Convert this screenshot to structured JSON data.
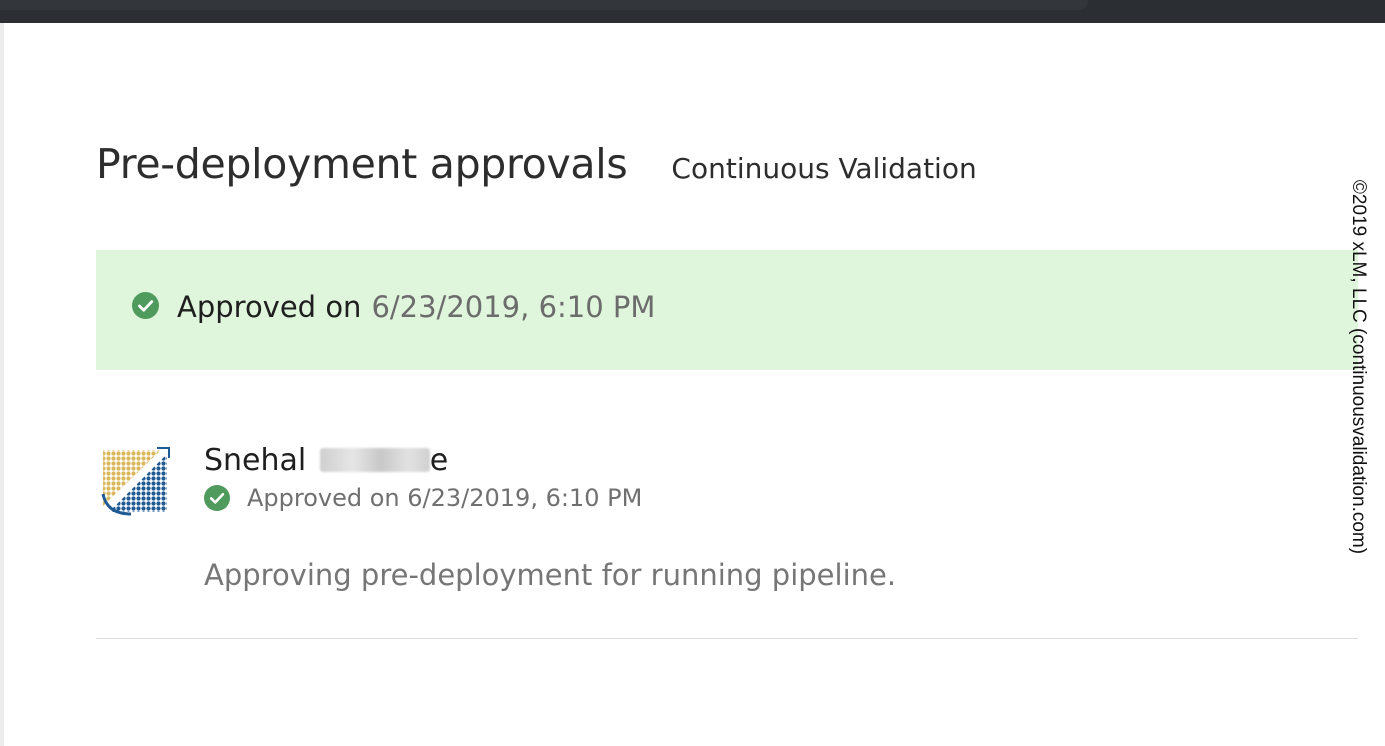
{
  "page": {
    "title": "Pre-deployment approvals",
    "release_name": "Continuous Validation"
  },
  "banner": {
    "label": "Approved on",
    "date": "6/23/2019, 6:10 PM",
    "icon": "check-circle-icon"
  },
  "approver": {
    "name_visible": "Snehal",
    "name_tail": "e",
    "status": "Approved on 6/23/2019, 6:10 PM",
    "comment": "Approving pre-deployment for running pipeline.",
    "avatar_icon": "company-logo-avatar"
  },
  "watermark": "©2019 xLM, LLC (continuousvalidation.com)",
  "colors": {
    "banner_bg": "#dff5dc",
    "check_green": "#4f9a5d",
    "topbar": "#2b2f33"
  }
}
